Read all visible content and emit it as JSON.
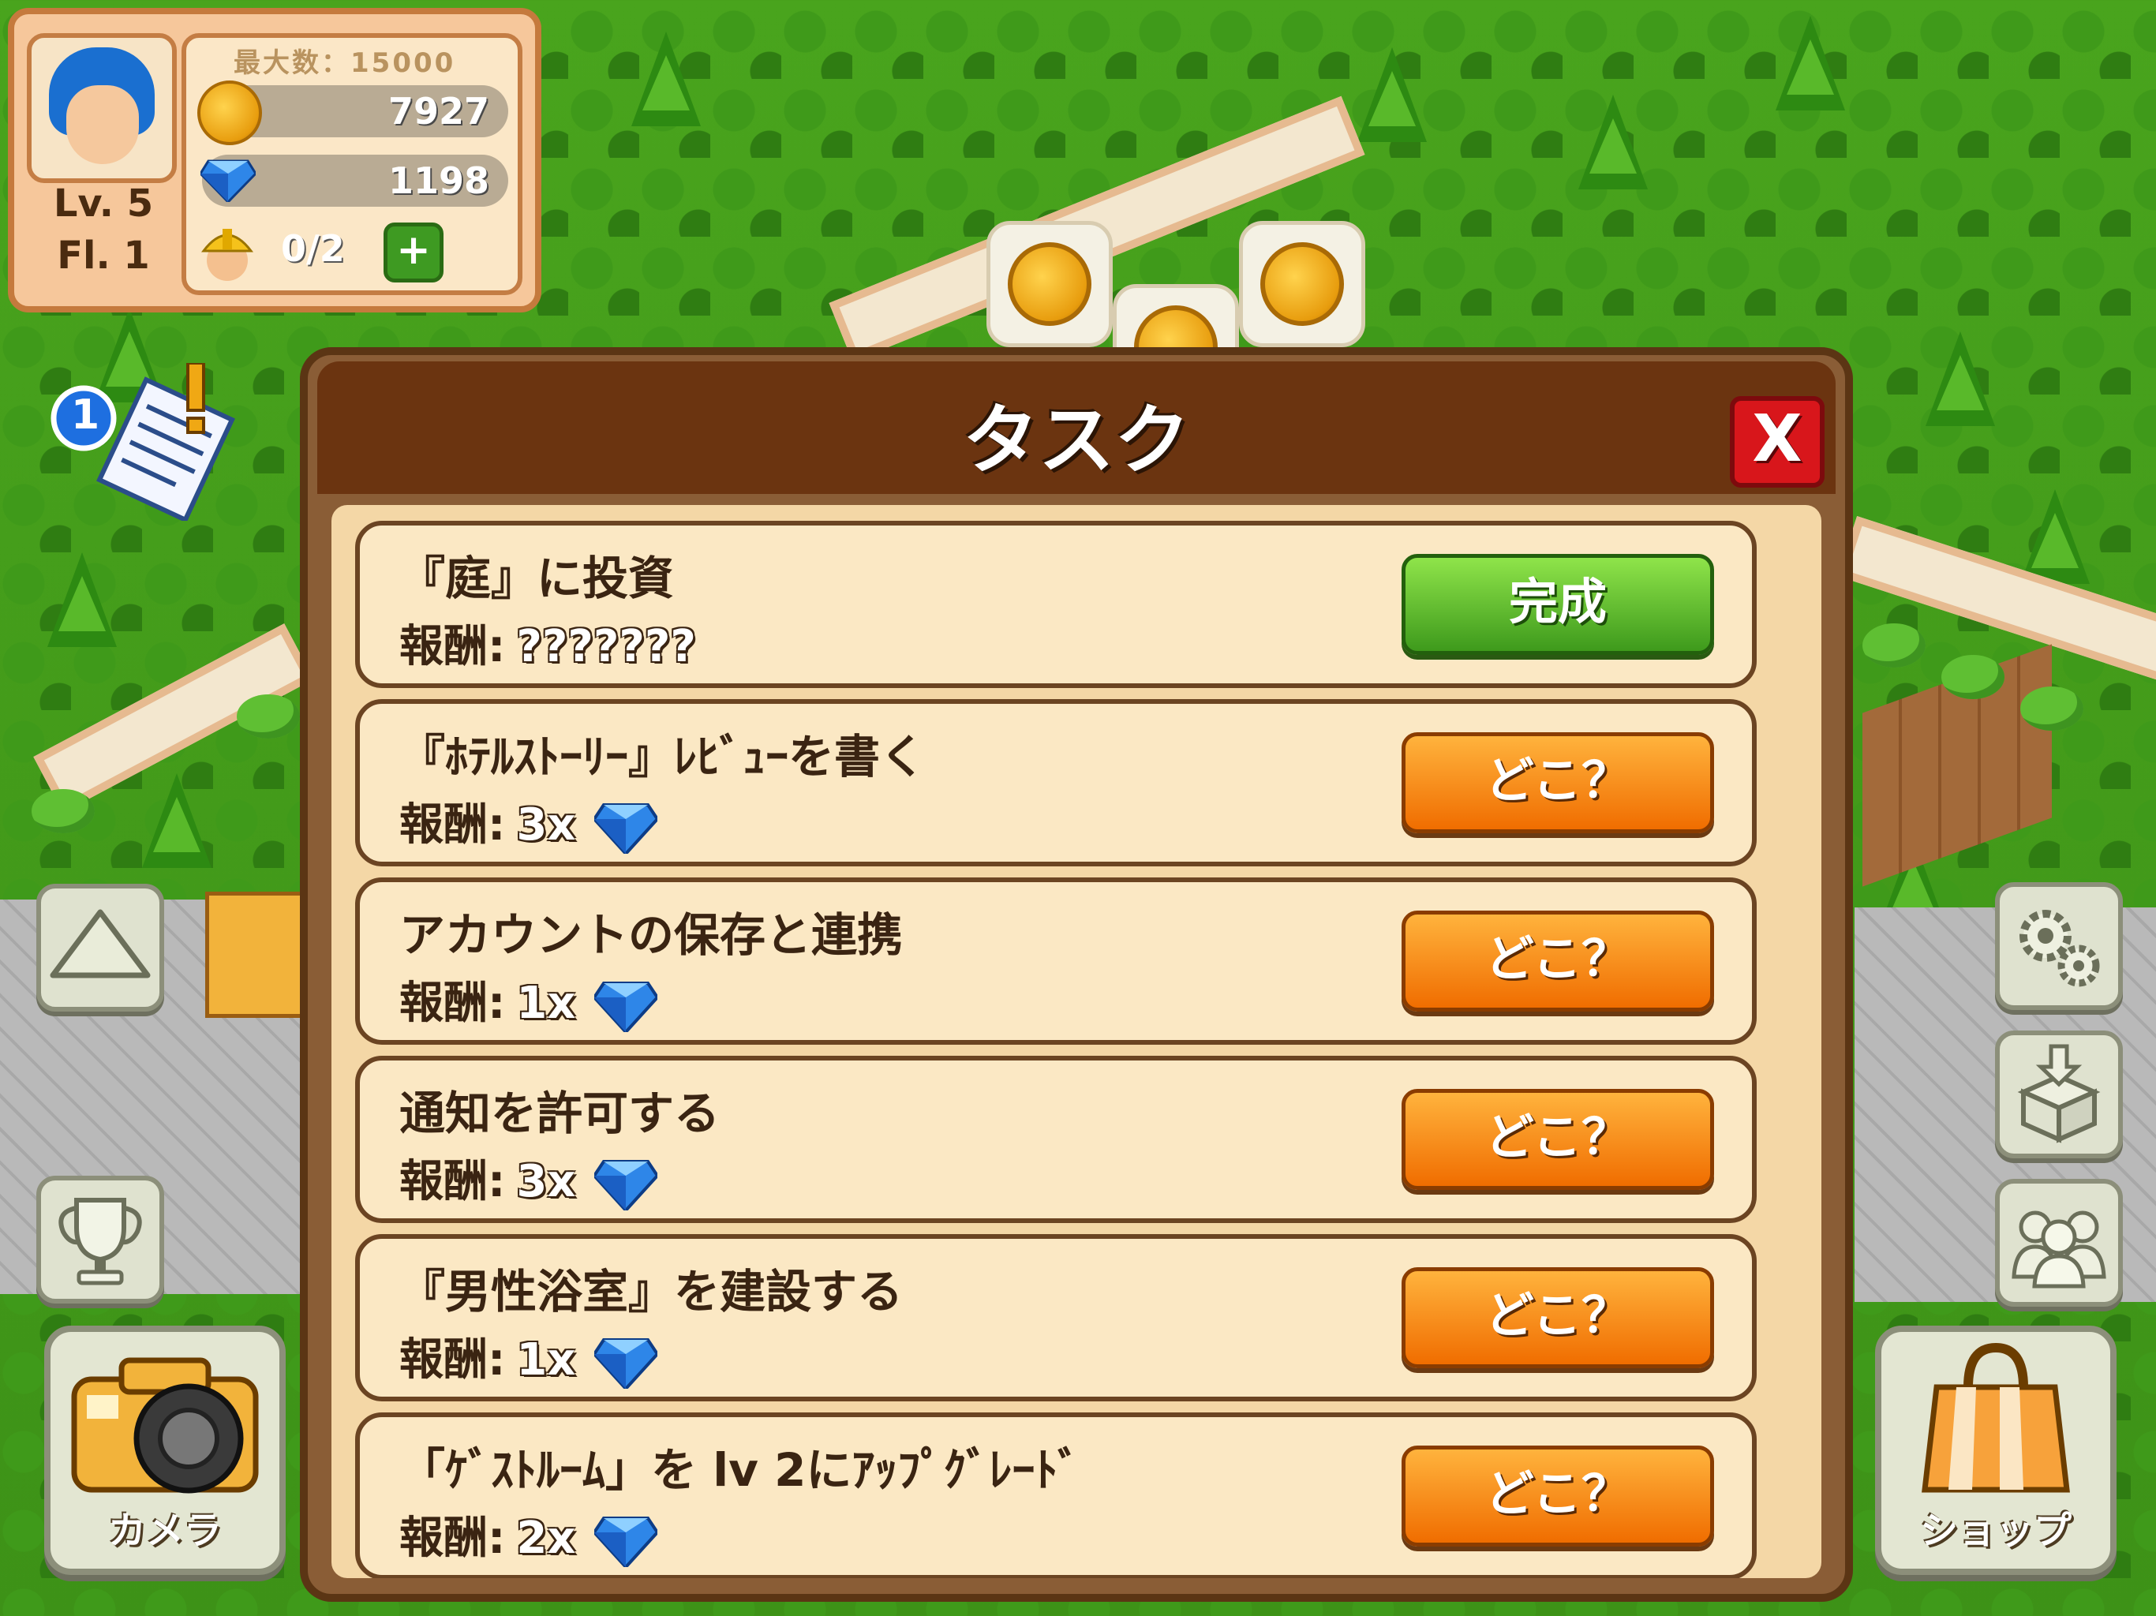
{
  "hud": {
    "max_label": "最大数：15000",
    "coins": "7927",
    "gems": "1198",
    "workers": "0/2",
    "level": "Lv. 5",
    "floor": "Fl. 1",
    "task_badge": "1"
  },
  "dialog": {
    "title": "タスク",
    "close_label": "X"
  },
  "tasks": [
    {
      "title": "『庭』に投資",
      "reward_label": "報酬:",
      "reward_value": "???????",
      "has_gem": false,
      "button": "完成",
      "button_style": "green"
    },
    {
      "title": "『ﾎﾃﾙｽﾄｰﾘｰ』ﾚﾋﾞｭｰを書く",
      "reward_label": "報酬:",
      "reward_value": "3x",
      "has_gem": true,
      "button": "どこ？",
      "button_style": "orange"
    },
    {
      "title": "アカウントの保存と連携",
      "reward_label": "報酬:",
      "reward_value": "1x",
      "has_gem": true,
      "button": "どこ？",
      "button_style": "orange"
    },
    {
      "title": "通知を許可する",
      "reward_label": "報酬:",
      "reward_value": "3x",
      "has_gem": true,
      "button": "どこ？",
      "button_style": "orange"
    },
    {
      "title": "『男性浴室』を建設する",
      "reward_label": "報酬:",
      "reward_value": "1x",
      "has_gem": true,
      "button": "どこ？",
      "button_style": "orange"
    },
    {
      "title": "「ｹﾞｽﾄﾙｰﾑ」を lv 2にｱｯﾌﾟｸﾞﾚｰﾄﾞ",
      "reward_label": "報酬:",
      "reward_value": "2x",
      "has_gem": true,
      "button": "どこ？",
      "button_style": "orange"
    }
  ],
  "buttons": {
    "camera": "カメラ",
    "shop": "ショップ"
  },
  "icons": {
    "avatar": "avatar-icon",
    "coin": "coin-icon",
    "gem": "gem-icon",
    "worker": "worker-icon",
    "plus": "plus-icon",
    "tasks": "task-list-icon",
    "up": "up-arrow-icon",
    "trophy": "trophy-icon",
    "camera": "camera-icon",
    "settings": "gear-icon",
    "storage": "storage-box-icon",
    "friends": "friends-icon",
    "shop": "shopping-bag-icon"
  },
  "colors": {
    "header_brown": "#6b3410",
    "button_orange": "#f06d00",
    "button_green": "#3e9a1c",
    "close_red": "#d8161b"
  }
}
